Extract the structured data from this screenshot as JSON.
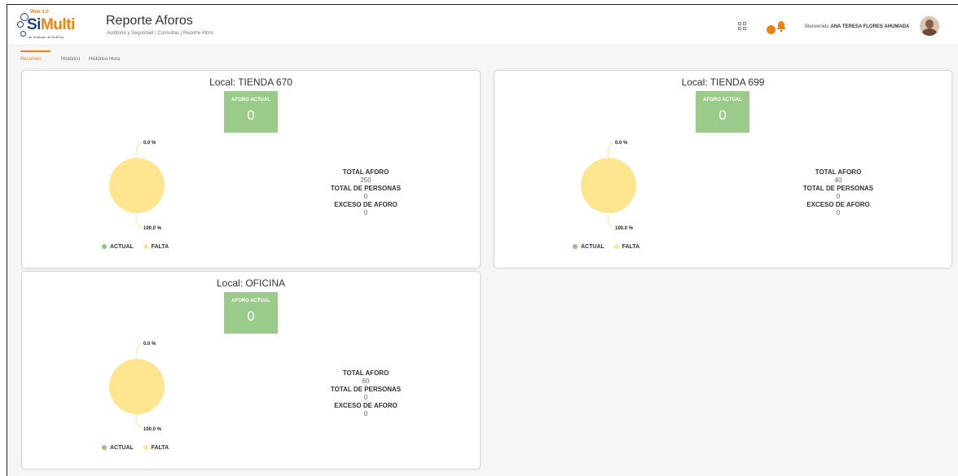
{
  "header": {
    "logo_small": "Web 3.0",
    "logo_si": "Si",
    "logo_multi": "Multi",
    "logo_tagline": "de Software de MultiTop",
    "title": "Reporte Aforos",
    "breadcrumb": "Auditoria y Seguridad  |  Consultas  |  Reporte Aforo",
    "notification_count": "0",
    "welcome_prefix": "Bienvenido",
    "user_name": "ANA TERESA FLORES AHUMADA"
  },
  "tabs": [
    {
      "label": "Resumen",
      "active": true
    },
    {
      "label": "Histórico",
      "active": false
    },
    {
      "label": "Histórico Hora",
      "active": false
    }
  ],
  "colors": {
    "accent": "#f0820f",
    "aforo_box": "#9acb8a",
    "actual": "#93c47d",
    "falta": "#ffe58f"
  },
  "cards": [
    {
      "title": "Local: TIENDA 670",
      "aforo_label": "AFORO ACTUAL",
      "aforo_value": "0",
      "pct_actual": "0.0 %",
      "pct_falta": "100.0 %",
      "legend_actual": "ACTUAL",
      "legend_falta": "FALTA",
      "total_aforo_label": "TOTAL AFORO",
      "total_aforo": "250",
      "total_personas_label": "TOTAL DE PERSONAS",
      "total_personas": "0",
      "exceso_label": "EXCESO DE AFORO",
      "exceso": "0"
    },
    {
      "title": "Local: TIENDA 699",
      "aforo_label": "AFORO ACTUAL",
      "aforo_value": "0",
      "pct_actual": "0.0 %",
      "pct_falta": "100.0 %",
      "legend_actual": "ACTUAL",
      "legend_falta": "FALTA",
      "total_aforo_label": "TOTAL AFORO",
      "total_aforo": "40",
      "total_personas_label": "TOTAL DE PERSONAS",
      "total_personas": "0",
      "exceso_label": "EXCESO DE AFORO",
      "exceso": "0"
    },
    {
      "title": "Local: OFICINA",
      "aforo_label": "AFORO ACTUAL",
      "aforo_value": "0",
      "pct_actual": "0.0 %",
      "pct_falta": "100.0 %",
      "legend_actual": "ACTUAL",
      "legend_falta": "FALTA",
      "total_aforo_label": "TOTAL AFORO",
      "total_aforo": "60",
      "total_personas_label": "TOTAL DE PERSONAS",
      "total_personas": "0",
      "exceso_label": "EXCESO DE AFORO",
      "exceso": "0"
    }
  ],
  "chart_data": [
    {
      "type": "pie",
      "categories": [
        "ACTUAL",
        "FALTA"
      ],
      "values": [
        0.0,
        100.0
      ],
      "legend": "bottom"
    },
    {
      "type": "pie",
      "categories": [
        "ACTUAL",
        "FALTA"
      ],
      "values": [
        0.0,
        100.0
      ],
      "legend": "bottom"
    },
    {
      "type": "pie",
      "categories": [
        "ACTUAL",
        "FALTA"
      ],
      "values": [
        0.0,
        100.0
      ],
      "legend": "bottom"
    }
  ]
}
